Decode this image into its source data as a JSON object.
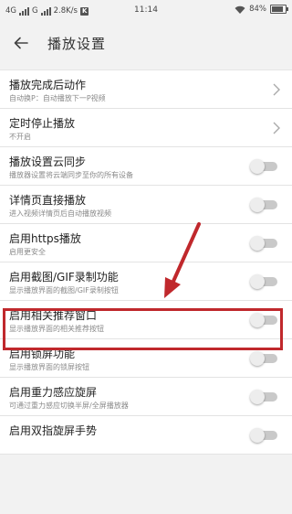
{
  "status_bar": {
    "network1": "4G",
    "network2": "G",
    "speed": "2.8K/s",
    "k_badge": "K",
    "time": "11:14",
    "battery": "84%",
    "battery_level": 0.84
  },
  "header": {
    "back_icon": "arrow-left-icon",
    "title": "播放设置"
  },
  "settings": [
    {
      "title": "播放完成后动作",
      "subtitle": "自动换P：自动播放下一P视频",
      "control": "chevron"
    },
    {
      "title": "定时停止播放",
      "subtitle": "不开启",
      "control": "chevron"
    },
    {
      "title": "播放设置云同步",
      "subtitle": "播放器设置将云端同步至你的所有设备",
      "control": "toggle",
      "on": false
    },
    {
      "title": "详情页直接播放",
      "subtitle": "进入视频详情页后自动播放视频",
      "control": "toggle",
      "on": false
    },
    {
      "title": "启用https播放",
      "subtitle": "启用更安全",
      "control": "toggle",
      "on": false
    },
    {
      "title": "启用截图/GIF录制功能",
      "subtitle": "显示播放界面的截图/GIF录制按钮",
      "control": "toggle",
      "on": false,
      "highlighted": true
    },
    {
      "title": "启用相关推荐窗口",
      "subtitle": "显示播放界面的相关推荐按钮",
      "control": "toggle",
      "on": false
    },
    {
      "title": "启用锁屏功能",
      "subtitle": "显示播放界面的锁屏按钮",
      "control": "toggle",
      "on": false
    },
    {
      "title": "启用重力感应旋屏",
      "subtitle": "可通过重力感应切换半屏/全屏播放器",
      "control": "toggle",
      "on": false
    },
    {
      "title": "启用双指旋屏手势",
      "subtitle": "",
      "control": "toggle",
      "on": false
    }
  ],
  "annotation": {
    "highlight_color": "#c0282c",
    "arrow_icon": "red-arrow-icon"
  }
}
